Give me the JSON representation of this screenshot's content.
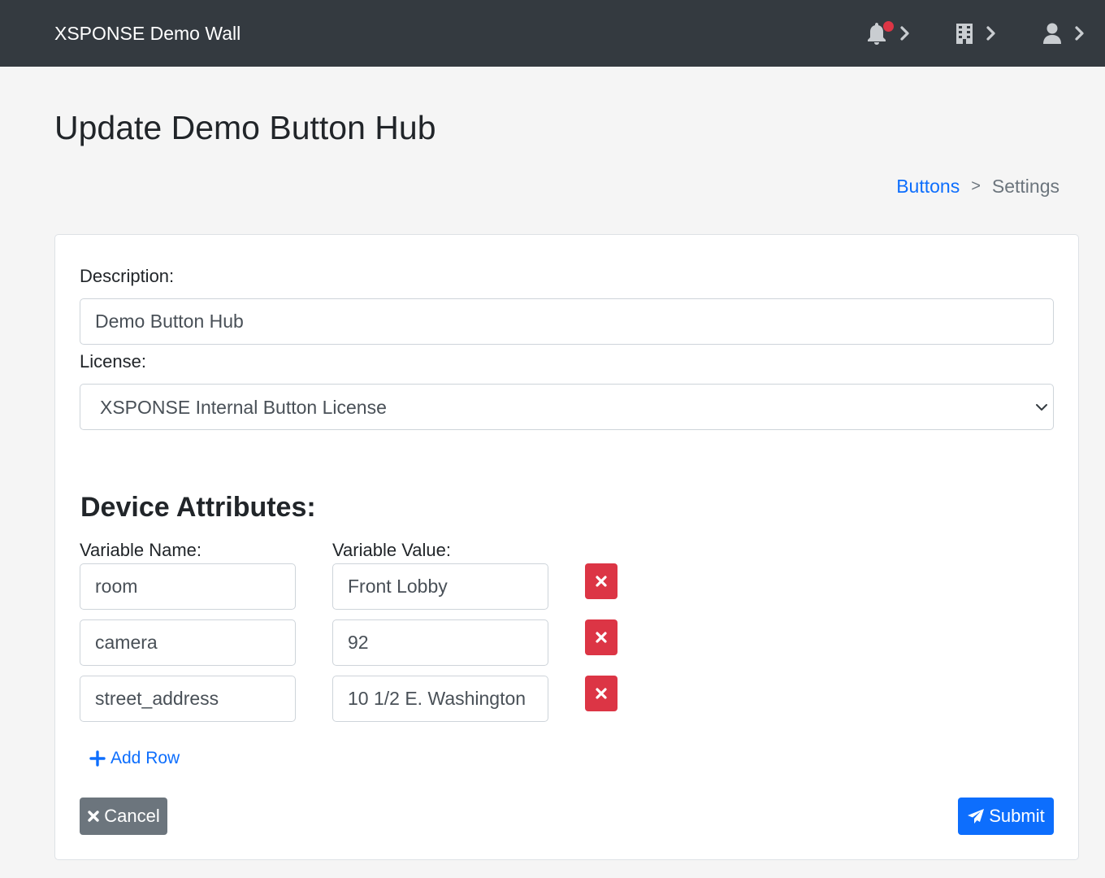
{
  "navbar": {
    "brand": "XSPONSE Demo Wall",
    "icons": [
      "bell-icon",
      "building-icon",
      "user-icon"
    ],
    "notification_dot_color": "#dc3545"
  },
  "page": {
    "title": "Update Demo Button Hub"
  },
  "breadcrumb": {
    "link": "Buttons",
    "separator": ">",
    "current": "Settings"
  },
  "form": {
    "description_label": "Description:",
    "description_value": "Demo Button Hub",
    "license_label": "License:",
    "license_selected": "XSPONSE Internal Button License"
  },
  "attributes": {
    "title": "Device Attributes:",
    "name_header": "Variable Name:",
    "value_header": "Variable Value:",
    "rows": [
      {
        "name": "room",
        "value": "Front Lobby"
      },
      {
        "name": "camera",
        "value": "92"
      },
      {
        "name": "street_address",
        "value": "10 1/2 E. Washington"
      }
    ],
    "add_row_label": "Add Row"
  },
  "actions": {
    "cancel_label": "Cancel",
    "submit_label": "Submit"
  },
  "colors": {
    "navbar": "#343a40",
    "primary": "#0d6efd",
    "danger": "#dc3545",
    "secondary": "#6c757d"
  }
}
